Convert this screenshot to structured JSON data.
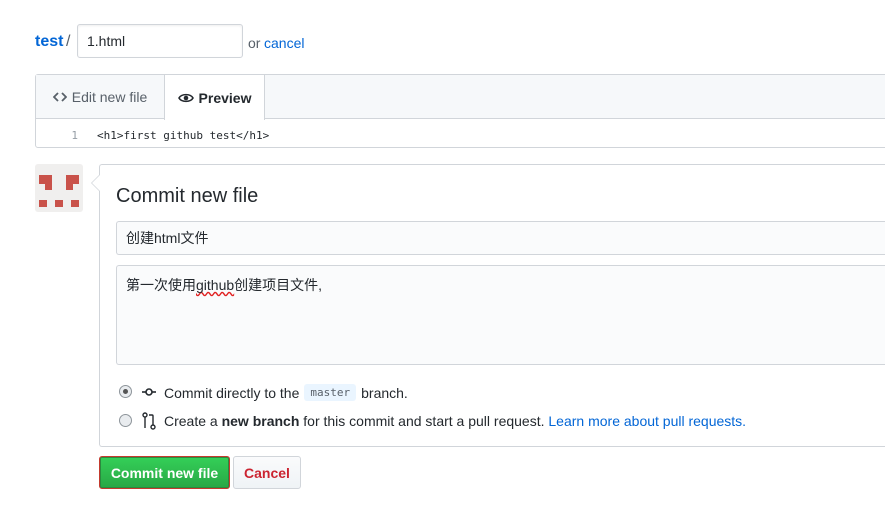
{
  "breadcrumb": {
    "repo": "test",
    "separator": "/",
    "filename_value": "1.html",
    "or_text": "or",
    "cancel_link": "cancel"
  },
  "editor": {
    "tabs": [
      {
        "label": "Edit new file",
        "icon": "code-icon",
        "active": false
      },
      {
        "label": "Preview",
        "icon": "eye-icon",
        "active": true
      }
    ],
    "code_lines": [
      {
        "number": "1",
        "text": "<h1>first github test</h1>"
      }
    ]
  },
  "commit": {
    "heading": "Commit new file",
    "summary_value": "创建html文件",
    "description_prefix": "第一次使用",
    "description_misspelled": "github",
    "description_suffix": "创建项目文件,",
    "options": {
      "direct": {
        "prefix": "Commit directly to the",
        "branch": "master",
        "suffix": "branch.",
        "icon": "git-commit-icon",
        "checked": true
      },
      "new_branch": {
        "prefix": "Create a",
        "bold": "new branch",
        "middle": "for this commit and start a pull request.",
        "link": "Learn more about pull requests.",
        "icon": "git-pull-request-icon",
        "checked": false
      }
    }
  },
  "buttons": {
    "commit": "Commit new file",
    "cancel": "Cancel"
  },
  "colors": {
    "link": "#0366d6",
    "primary_button": "#28a745",
    "danger_text": "#cb2431",
    "border": "#d1d5da",
    "avatar_red": "#c9524a"
  }
}
